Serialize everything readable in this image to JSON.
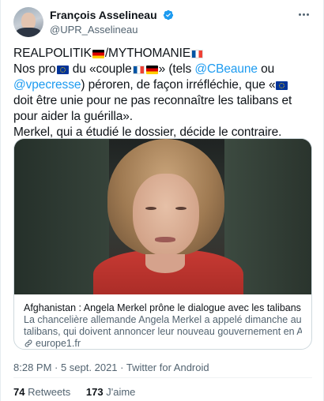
{
  "author": {
    "display_name": "François Asselineau",
    "handle": "@UPR_Asselineau"
  },
  "icons": {
    "verified": "verified-badge-icon",
    "more": "more-options-icon",
    "link": "link-icon",
    "flag_de": "germany-flag-emoji",
    "flag_fr": "france-flag-emoji",
    "flag_eu": "eu-flag-emoji"
  },
  "tweet": {
    "line1": "REALPOLITIK",
    "line1b": "/MYTHOMANIE",
    "line2a": "Nos pro",
    "line2b": " du «couple",
    "line2c": "» (tels ",
    "mention1": "@CBeaune",
    "line2d": " ou",
    "mention2": "@vpecresse",
    "line3a": ") péroren, de façon irréfléchie, que «",
    "line4": "doit être unie pour ne pas reconnaître les talibans et",
    "line5": "pour aider la guérilla».",
    "line6": "Merkel, qui a étudié le dossier, décide le contraire."
  },
  "card": {
    "title": "Afghanistan : Angela Merkel prône le dialogue avec les talibans",
    "desc_line1": "La chancelière allemande Angela Merkel a appelé dimanche au dialogue avec les",
    "desc_line2": "talibans, qui doivent annoncer leur nouveau gouvernement en Afghanistan, po...",
    "domain": "europe1.fr"
  },
  "meta": {
    "text": "8:28 PM · 5 sept. 2021 · Twitter for Android"
  },
  "stats": {
    "retweets_count": "74",
    "retweets_label": "Retweets",
    "likes_count": "173",
    "likes_label": "J'aime"
  },
  "colors": {
    "link": "#1d9bf0",
    "secondary_text": "#536471",
    "primary_text": "#0f1419",
    "border": "#cfd9de"
  }
}
